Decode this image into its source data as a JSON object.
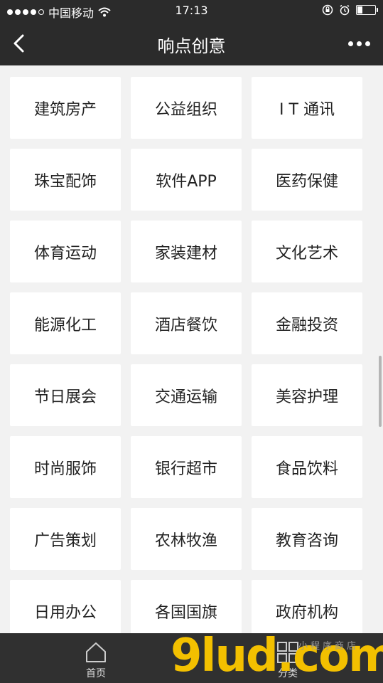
{
  "status": {
    "carrier": "中国移动",
    "time": "17:13"
  },
  "nav": {
    "title": "响点创意"
  },
  "grid": {
    "items": [
      "建筑房产",
      "公益组织",
      "I T 通讯",
      "珠宝配饰",
      "软件APP",
      "医药保健",
      "体育运动",
      "家装建材",
      "文化艺术",
      "能源化工",
      "酒店餐饮",
      "金融投资",
      "节日展会",
      "交通运输",
      "美容护理",
      "时尚服饰",
      "银行超市",
      "食品饮料",
      "广告策划",
      "农林牧渔",
      "教育咨询",
      "日用办公",
      "各国国旗",
      "政府机构"
    ]
  },
  "tabbar": {
    "home_label": "首页",
    "category_label": "分类"
  },
  "watermark": {
    "logo_text": "9lud.com",
    "tagline": "小程序商店"
  },
  "colors": {
    "header_bg": "#2b2b2b",
    "page_bg": "#f2f2f2",
    "tile_bg": "#ffffff",
    "tabbar_bg": "#303030",
    "watermark_yellow": "#f3c000"
  }
}
